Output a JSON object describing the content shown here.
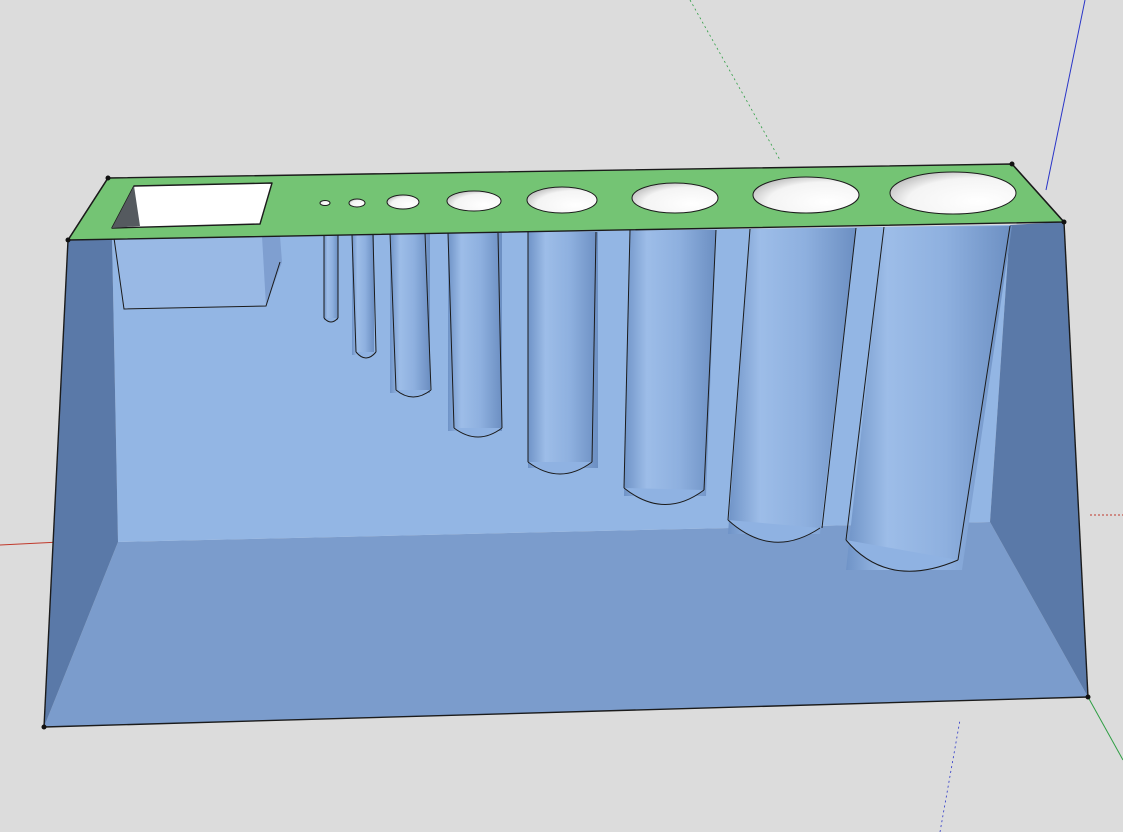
{
  "viewport": {
    "background_color": "#dcdcdc",
    "axis_colors": {
      "red": "#c0392b",
      "green": "#2e9e43",
      "blue": "#2a35c8"
    }
  },
  "model": {
    "top_face_color": "#74c474",
    "front_face_color": "#93b6e4",
    "floor_color": "#7b9ccc",
    "side_face_color": "#5a79a8",
    "cylinder_color": "#8fb2e2",
    "hole_count": 8,
    "square_opening_count": 1
  }
}
